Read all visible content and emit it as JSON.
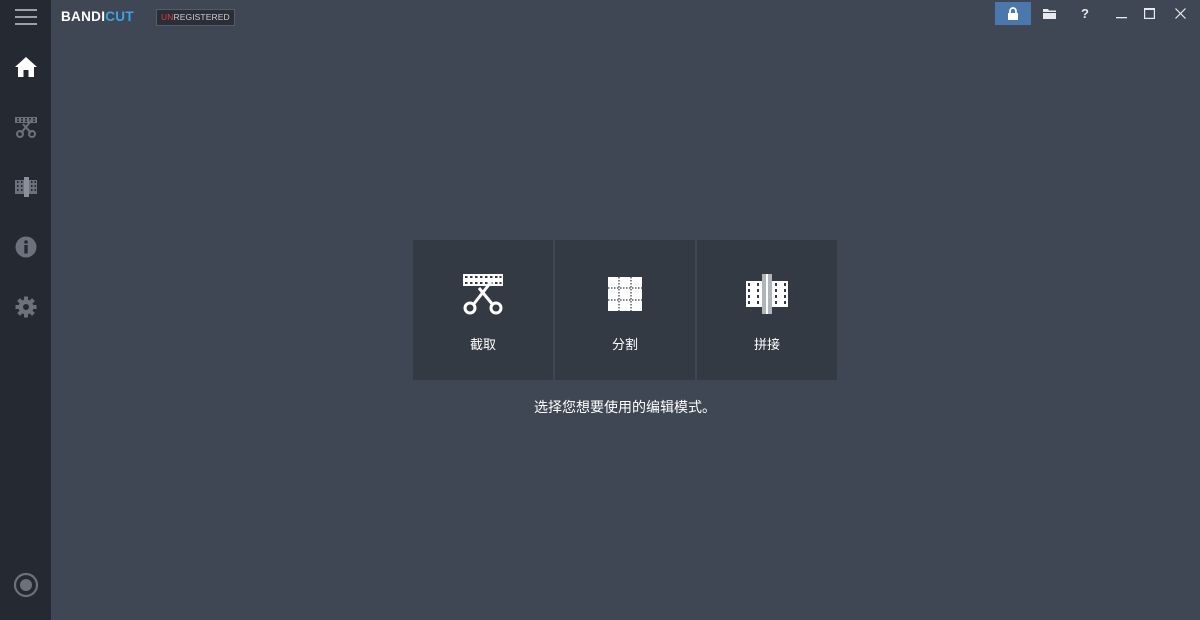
{
  "app": {
    "brand_main": "BANDI",
    "brand_accent": "CUT",
    "badge_un": "UN",
    "badge_rest": "REGISTERED"
  },
  "sidebar": {
    "items": [
      {
        "icon": "menu-icon"
      },
      {
        "icon": "home-icon"
      },
      {
        "icon": "cut-mode-icon"
      },
      {
        "icon": "join-mode-icon"
      },
      {
        "icon": "info-icon"
      },
      {
        "icon": "settings-icon"
      },
      {
        "icon": "record-icon"
      }
    ]
  },
  "titlebar": {
    "buttons": [
      "lock-icon",
      "folder-icon",
      "help-icon",
      "minimize-icon",
      "maximize-icon",
      "close-icon"
    ],
    "help_label": "?"
  },
  "modes": [
    {
      "label": "截取",
      "icon": "scissors-film-icon"
    },
    {
      "label": "分割",
      "icon": "grid-split-icon"
    },
    {
      "label": "拼接",
      "icon": "join-film-icon"
    }
  ],
  "hint": "选择您想要使用的编辑模式。",
  "colors": {
    "background": "#3f4754",
    "sidebar": "#252a32",
    "tile": "#333a44",
    "accent": "#3aa4e8",
    "active_button": "#4a78ad",
    "unregistered": "#e03a3a"
  }
}
